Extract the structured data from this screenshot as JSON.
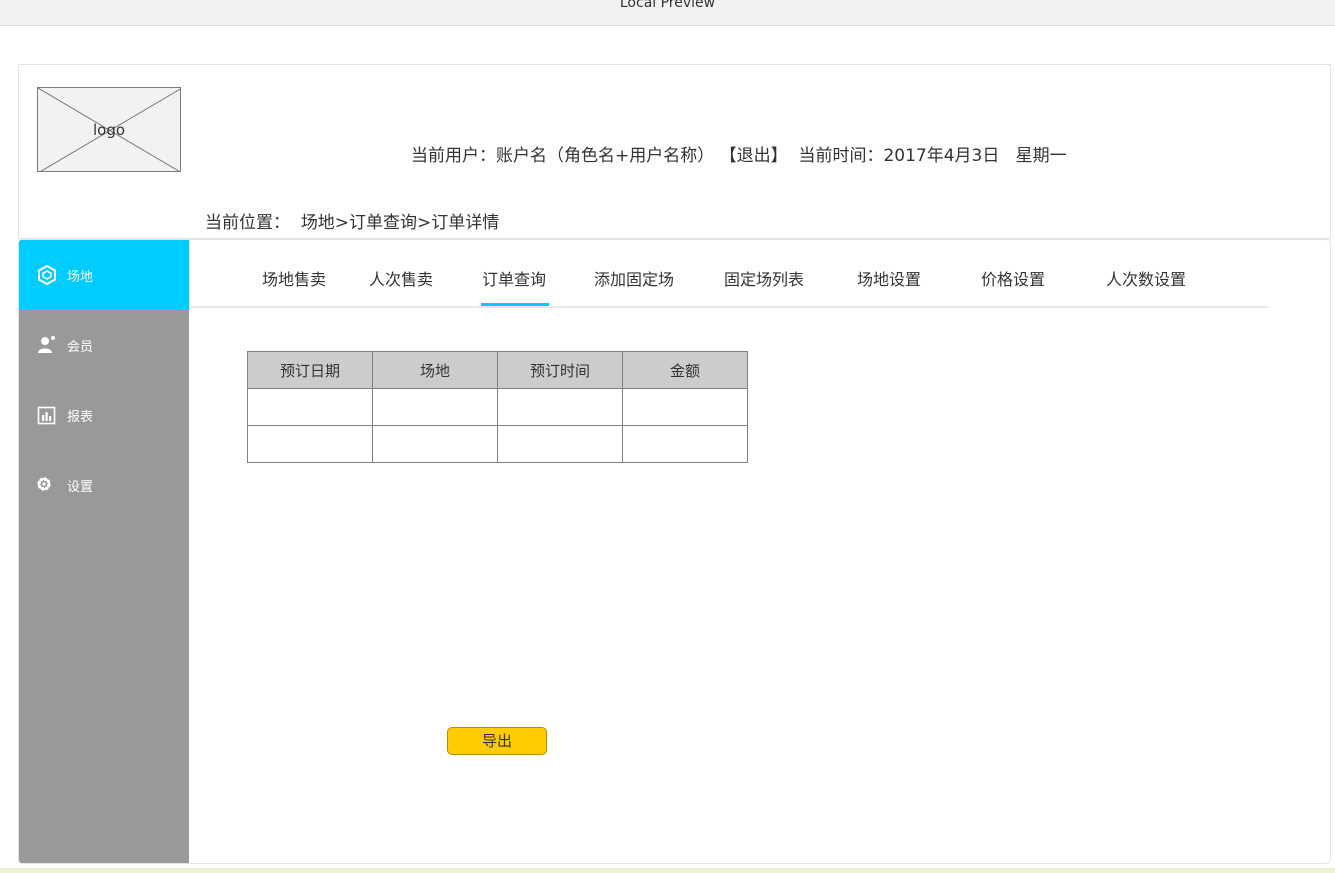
{
  "window": {
    "title": "Local Preview"
  },
  "header": {
    "logo_text": "logo",
    "user_label": "当前用户：",
    "user_value": "账户名（角色名+用户名称）",
    "logout": "【退出】",
    "time_label": "当前时间：",
    "time_value": "2017年4月3日",
    "weekday": "星期一"
  },
  "breadcrumb": {
    "label": "当前位置：",
    "path": "场地>订单查询>订单详情"
  },
  "sidebar": {
    "items": [
      {
        "label": "场地",
        "icon": "venue-icon",
        "active": true
      },
      {
        "label": "会员",
        "icon": "member-icon",
        "active": false
      },
      {
        "label": "报表",
        "icon": "report-icon",
        "active": false
      },
      {
        "label": "设置",
        "icon": "gear-icon",
        "active": false
      }
    ]
  },
  "tabs": [
    {
      "label": "场地售卖",
      "active": false
    },
    {
      "label": "人次售卖",
      "active": false
    },
    {
      "label": "订单查询",
      "active": true
    },
    {
      "label": "添加固定场",
      "active": false
    },
    {
      "label": "固定场列表",
      "active": false
    },
    {
      "label": "场地设置",
      "active": false
    },
    {
      "label": "价格设置",
      "active": false
    },
    {
      "label": "人次数设置",
      "active": false
    }
  ],
  "table": {
    "columns": [
      "预订日期",
      "场地",
      "预订时间",
      "金额"
    ],
    "rows": [
      [
        "",
        "",
        "",
        ""
      ],
      [
        "",
        "",
        "",
        ""
      ]
    ]
  },
  "actions": {
    "export_label": "导出"
  },
  "colors": {
    "accent": "#00ccff",
    "sidebar": "#999999",
    "export_button": "#ffcc00",
    "table_header": "#cccccc"
  }
}
